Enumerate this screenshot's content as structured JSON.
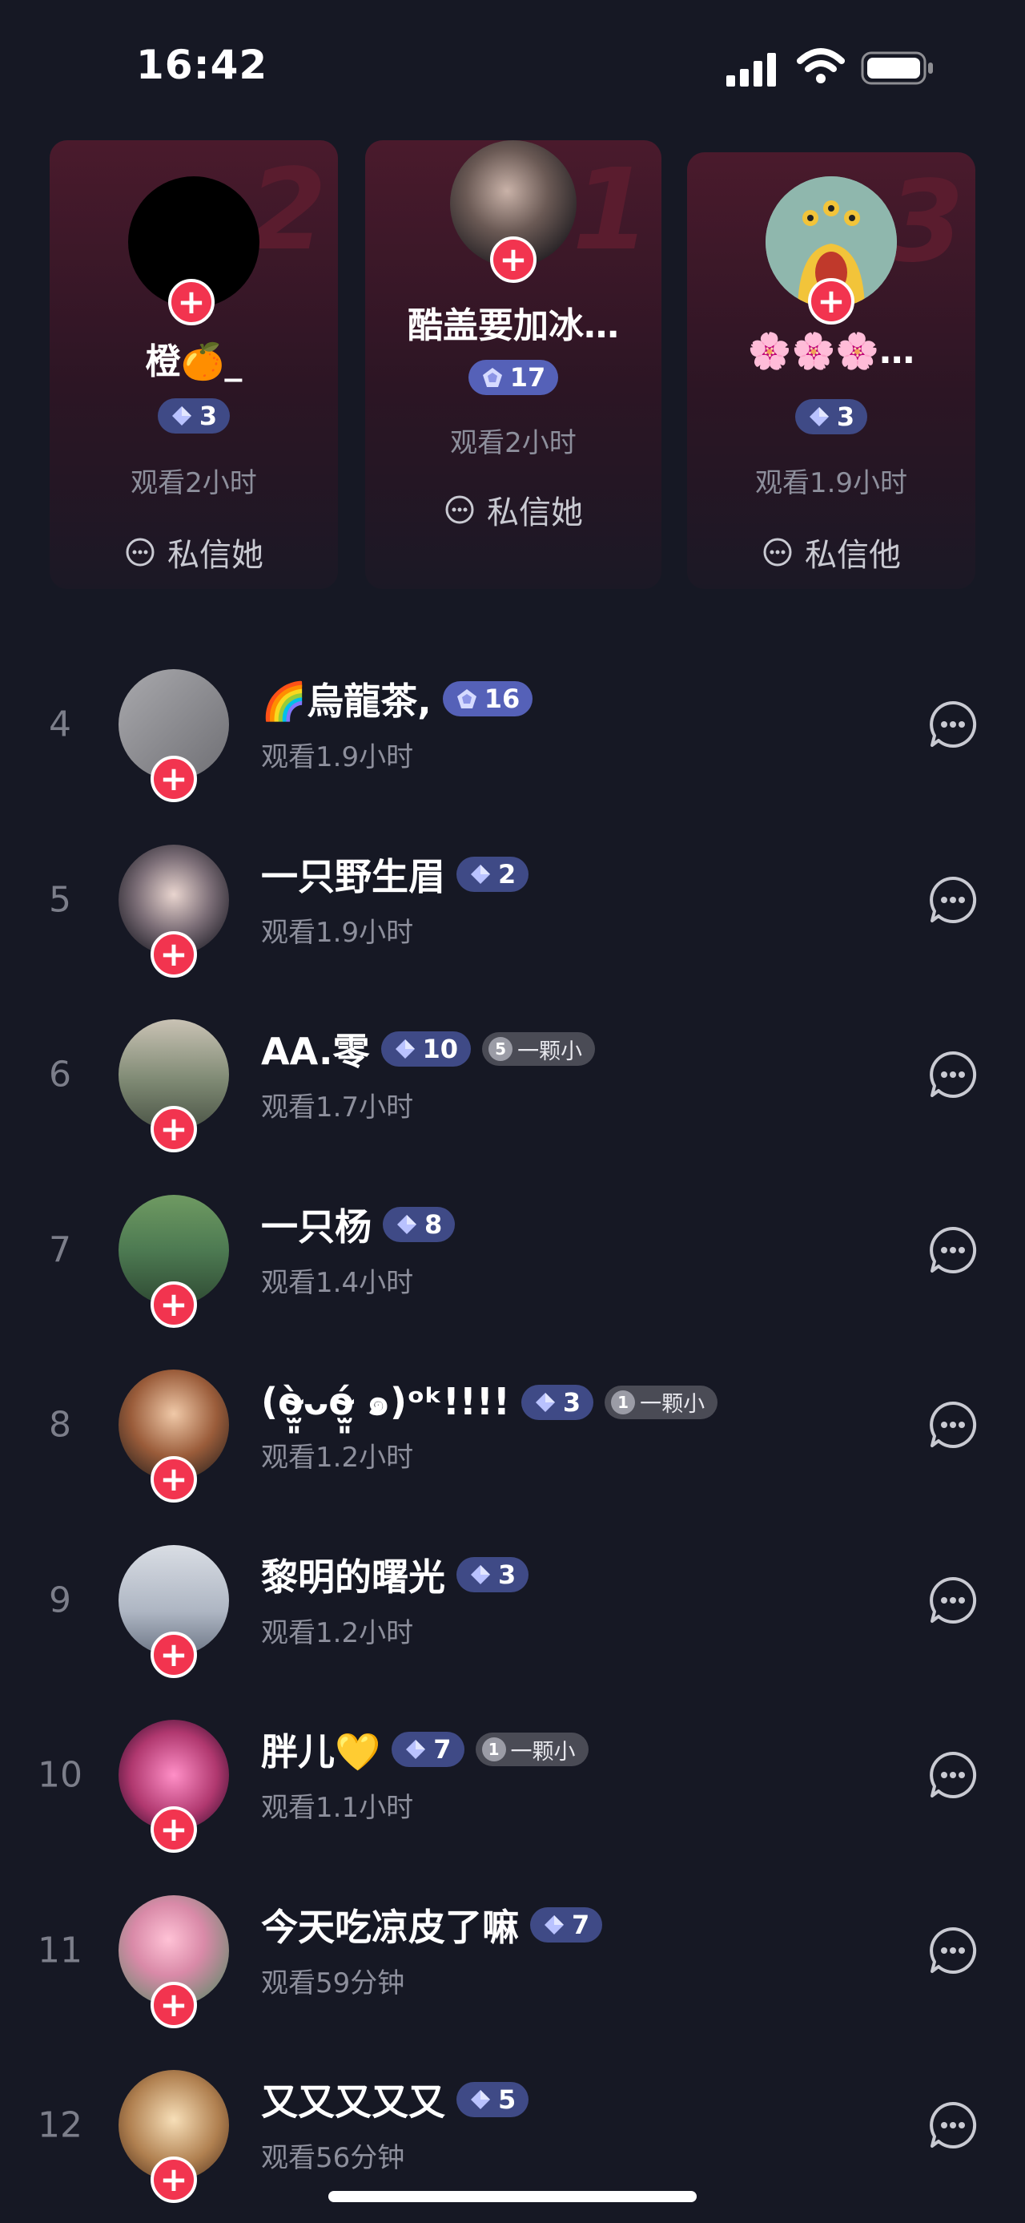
{
  "status_bar": {
    "time": "16:42"
  },
  "podium": [
    {
      "rank": "2",
      "name": "橙🍊_",
      "level": "3",
      "watch": "观看2小时",
      "message": "私信她"
    },
    {
      "rank": "1",
      "name": "酷盖要加冰…",
      "level": "17",
      "watch": "观看2小时",
      "message": "私信她"
    },
    {
      "rank": "3",
      "name": "🌸🌸🌸…",
      "level": "3",
      "watch": "观看1.9小时",
      "message": "私信他"
    }
  ],
  "list": [
    {
      "rank": "4",
      "name": "🌈烏龍茶,",
      "level": "16",
      "watch": "观看1.9小时",
      "fan": null
    },
    {
      "rank": "5",
      "name": "一只野生眉",
      "level": "2",
      "watch": "观看1.9小时",
      "fan": null
    },
    {
      "rank": "6",
      "name": "AA.零",
      "level": "10",
      "watch": "观看1.7小时",
      "fan": {
        "num": "5",
        "label": "一颗小"
      }
    },
    {
      "rank": "7",
      "name": "一只杨",
      "level": "8",
      "watch": "观看1.4小时",
      "fan": null
    },
    {
      "rank": "8",
      "name": "(ò̴̫͈ᴗó̴̫͈ ๑)ᵒᵏ!!!!",
      "level": "3",
      "watch": "观看1.2小时",
      "fan": {
        "num": "1",
        "label": "一颗小"
      }
    },
    {
      "rank": "9",
      "name": "黎明的曙光",
      "level": "3",
      "watch": "观看1.2小时",
      "fan": null
    },
    {
      "rank": "10",
      "name": "胖儿💛",
      "level": "7",
      "watch": "观看1.1小时",
      "fan": {
        "num": "1",
        "label": "一颗小"
      }
    },
    {
      "rank": "11",
      "name": "今天吃凉皮了嘛",
      "level": "7",
      "watch": "观看59分钟",
      "fan": null
    },
    {
      "rank": "12",
      "name": "又又又又又",
      "level": "5",
      "watch": "观看56分钟",
      "fan": null
    }
  ],
  "colors": {
    "background": "#161824",
    "accent_red": "#f2344f",
    "level_badge": "#3f4a86",
    "muted_text": "#8d8f9c"
  }
}
